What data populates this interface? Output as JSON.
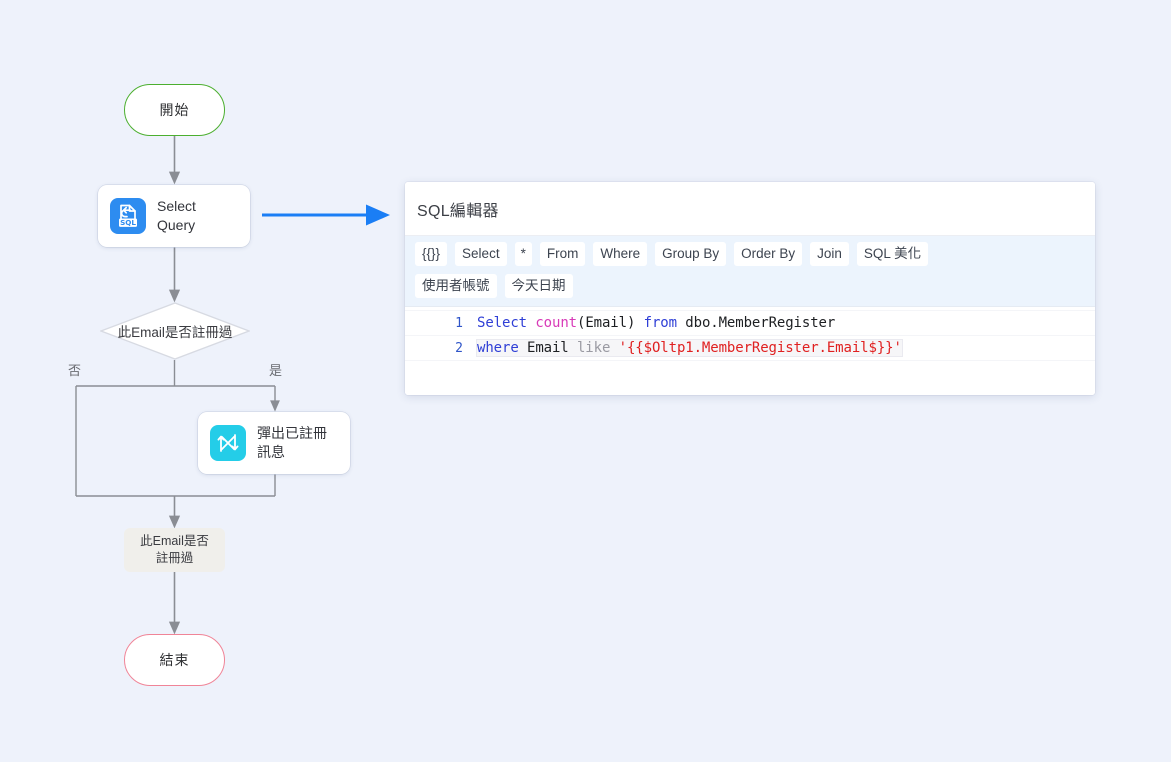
{
  "canvas": {
    "background": "#eef2fb"
  },
  "flow": {
    "start_node": {
      "label": "開始",
      "shape": "terminator",
      "border_color": "#4caf2f"
    },
    "sql_node": {
      "label": "Select\nQuery",
      "icon": "sql-file-icon",
      "icon_color": "#2d8cf0"
    },
    "decision_node": {
      "label": "此Email是否註冊過",
      "shape": "diamond",
      "border_color": "#d7dae2"
    },
    "branch_labels": {
      "no": "否",
      "yes": "是"
    },
    "popup_node": {
      "label": "彈出已註冊\n訊息",
      "icon": "swap-arrows-icon",
      "icon_color": "#24cde8"
    },
    "annotation_node": {
      "label": "此Email是否\n註冊過",
      "background": "#f0efeb"
    },
    "end_node": {
      "label": "結束",
      "shape": "terminator",
      "border_color": "#f08497"
    },
    "connector_arrow": {
      "name": "pointer-to-editor",
      "color": "#1a7ef5"
    },
    "edge_color": "#8a8d94"
  },
  "editor": {
    "title": "SQL編輯器",
    "toolbar_rows": [
      [
        {
          "label": "{{}}",
          "name": "tool-variable-braces"
        },
        {
          "label": "Select",
          "name": "tool-select"
        },
        {
          "label": "*",
          "name": "tool-asterisk"
        },
        {
          "label": "From",
          "name": "tool-from"
        },
        {
          "label": "Where",
          "name": "tool-where"
        },
        {
          "label": "Group By",
          "name": "tool-group-by"
        },
        {
          "label": "Order By",
          "name": "tool-order-by"
        },
        {
          "label": "Join",
          "name": "tool-join"
        },
        {
          "label": "SQL 美化",
          "name": "tool-sql-beautify"
        }
      ],
      [
        {
          "label": "使用者帳號",
          "name": "tool-user-account"
        },
        {
          "label": "今天日期",
          "name": "tool-today-date"
        }
      ]
    ],
    "code": {
      "lines": [
        {
          "number": "1",
          "active": false,
          "tokens": [
            {
              "text": "Select",
              "type": "kw"
            },
            {
              "text": " ",
              "type": "id"
            },
            {
              "text": "count",
              "type": "fn"
            },
            {
              "text": "(Email) ",
              "type": "id"
            },
            {
              "text": "from",
              "type": "kw"
            },
            {
              "text": " dbo.MemberRegister",
              "type": "id"
            }
          ],
          "plain": "Select count(Email) from dbo.MemberRegister"
        },
        {
          "number": "2",
          "active": true,
          "tokens": [
            {
              "text": "where",
              "type": "kw"
            },
            {
              "text": " Email ",
              "type": "id"
            },
            {
              "text": "like",
              "type": "dim"
            },
            {
              "text": " ",
              "type": "id"
            },
            {
              "text": "'{{$Oltp1.MemberRegister.Email$}}'",
              "type": "str"
            }
          ],
          "plain": "where Email like '{{$Oltp1.MemberRegister.Email$}}'"
        }
      ]
    },
    "colors": {
      "toolbar_bg": "#ecf4fd",
      "keyword": "#2f3fd6",
      "function": "#d83bb8",
      "string": "#e02020",
      "dim": "#9a9aa2",
      "gutter": "#2f55c8"
    }
  }
}
